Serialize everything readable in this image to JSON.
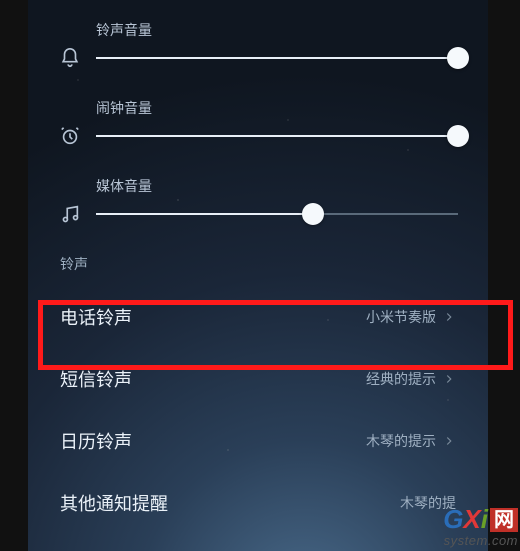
{
  "sliders": {
    "ring": {
      "label": "铃声音量",
      "percent": 100
    },
    "alarm": {
      "label": "闹钟音量",
      "percent": 100
    },
    "media": {
      "label": "媒体音量",
      "percent": 60
    }
  },
  "section": {
    "header": "铃声"
  },
  "rows": {
    "phone": {
      "title": "电话铃声",
      "value": "小米节奏版"
    },
    "sms": {
      "title": "短信铃声",
      "value": "经典的提示"
    },
    "calendar": {
      "title": "日历铃声",
      "value": "木琴的提示"
    },
    "other": {
      "title": "其他通知提醒",
      "value": "木琴的提"
    }
  },
  "watermark": {
    "g": "G",
    "x": "X",
    "i": "i",
    "net": "网",
    "url": "system.com"
  }
}
